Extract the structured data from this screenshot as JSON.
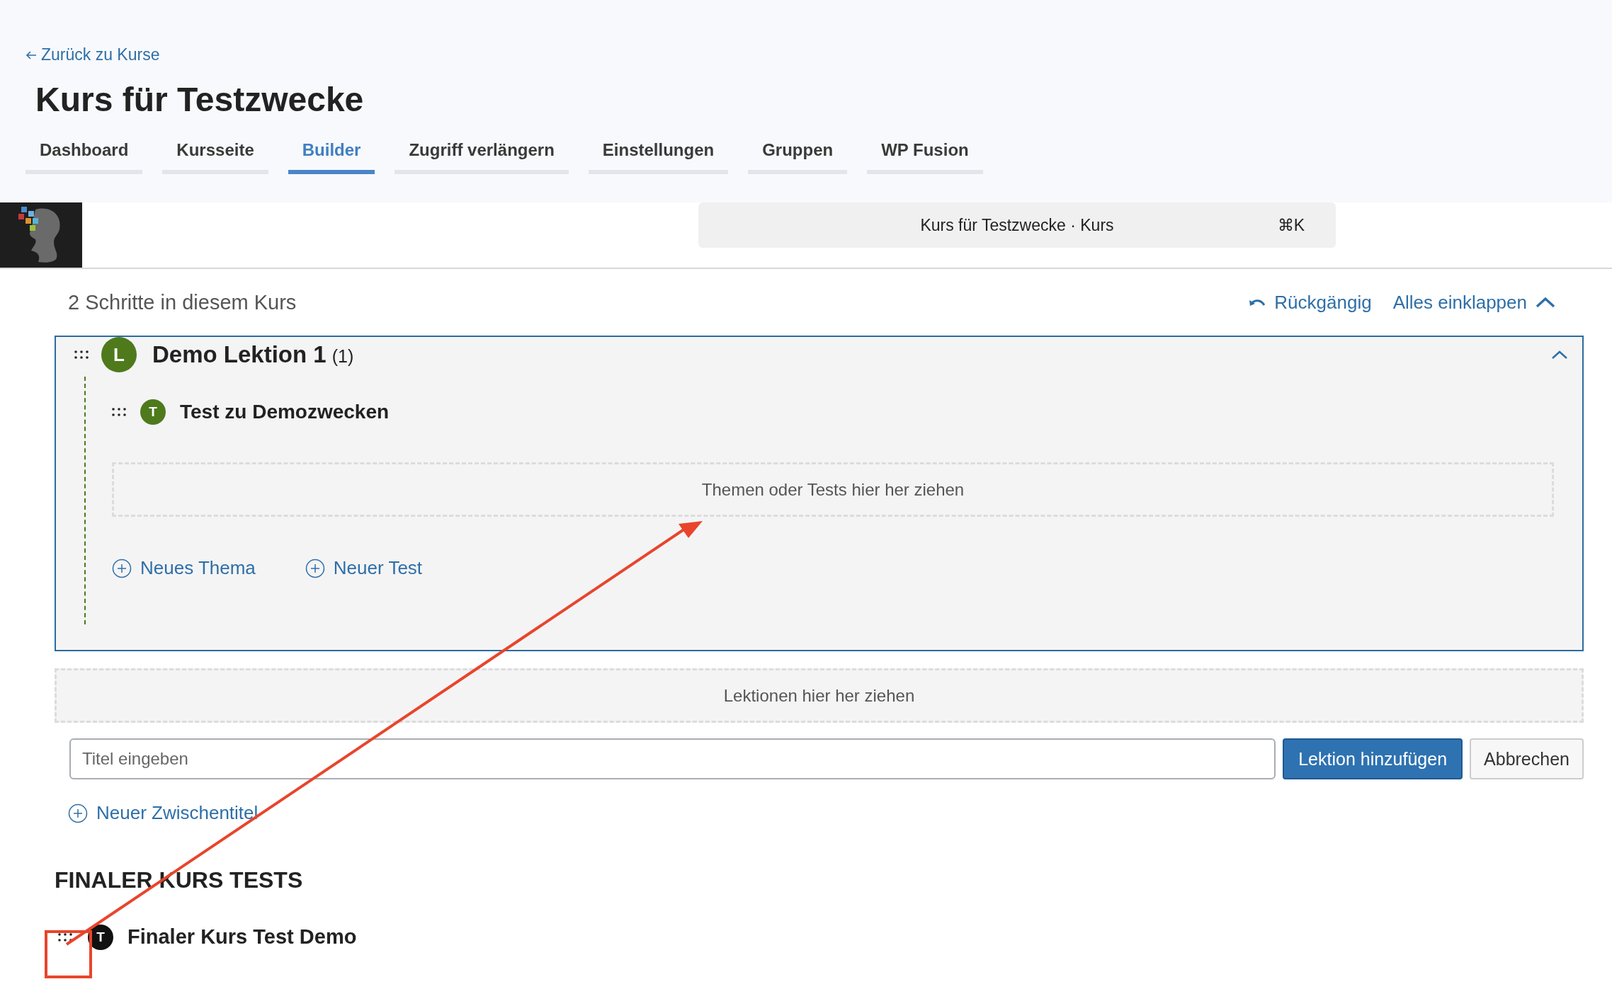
{
  "back_link": "Zurück zu Kurse",
  "title": "Kurs für Testzwecke",
  "tabs": [
    {
      "label": "Dashboard",
      "selected": false
    },
    {
      "label": "Kursseite",
      "selected": false
    },
    {
      "label": "Builder",
      "selected": true
    },
    {
      "label": "Zugriff verlängern",
      "selected": false
    },
    {
      "label": "Einstellungen",
      "selected": false
    },
    {
      "label": "Gruppen",
      "selected": false
    },
    {
      "label": "WP Fusion",
      "selected": false
    }
  ],
  "command_bar": {
    "label": "Kurs für Testzwecke · Kurs",
    "shortcut": "⌘K"
  },
  "builder": {
    "step_count": "2 Schritte in diesem Kurs",
    "undo": "Rückgängig",
    "collapse_all": "Alles einklappen"
  },
  "lessons": [
    {
      "badge": "L",
      "color": "#4e7a1c",
      "title": "Demo Lektion 1",
      "count": "(1)",
      "expanded": true,
      "items": [
        {
          "badge": "T",
          "color": "#4e7a1c",
          "title": "Test zu Demozwecken"
        }
      ],
      "drop_hint": "Themen oder Tests hier her ziehen",
      "actions": [
        "Neues Thema",
        "Neuer Test"
      ]
    }
  ],
  "lesson_drop_hint": "Lektionen hier her ziehen",
  "new_lesson": {
    "placeholder": "Titel eingeben",
    "add_button": "Lektion hinzufügen",
    "cancel_button": "Abbrechen"
  },
  "new_section": "Neuer Zwischentitel",
  "final_tests": {
    "heading": "FINALER KURS TESTS",
    "items": [
      {
        "badge": "T",
        "color": "#111111",
        "title": "Finaler Kurs Test Demo"
      }
    ]
  }
}
